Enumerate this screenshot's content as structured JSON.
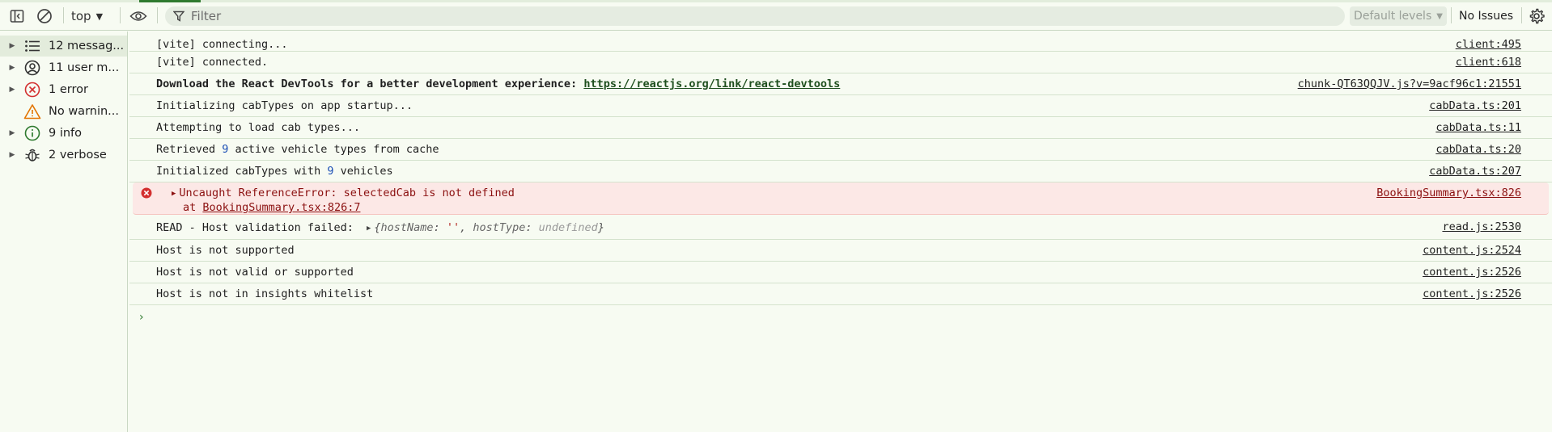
{
  "toolbar": {
    "context": "top",
    "filter_placeholder": "Filter",
    "levels_label": "Default levels",
    "issues_label": "No Issues"
  },
  "sidebar": {
    "items": [
      {
        "label": "12 messag...",
        "icon": "list-icon",
        "selected": true
      },
      {
        "label": "11 user m...",
        "icon": "user-icon"
      },
      {
        "label": "1 error",
        "icon": "error-icon"
      },
      {
        "label": "No warnin...",
        "icon": "warning-icon"
      },
      {
        "label": "9 info",
        "icon": "info-icon"
      },
      {
        "label": "2 verbose",
        "icon": "bug-icon"
      }
    ]
  },
  "console": {
    "rows": [
      {
        "text": "[vite] connecting...",
        "source": "client:495"
      },
      {
        "text": "[vite] connected.",
        "source": "client:618"
      },
      {
        "text": "Download the React DevTools for a better development experience: ",
        "link": "https://reactjs.org/link/react-devtools",
        "source": "chunk-QT63QQJV.js?v=9acf96c1:21551"
      },
      {
        "text": "Initializing cabTypes on app startup...",
        "source": "cabData.ts:201"
      },
      {
        "text": "Attempting to load cab types...",
        "source": "cabData.ts:11"
      },
      {
        "text_a": "Retrieved ",
        "num": "9",
        "text_b": " active vehicle types from cache",
        "source": "cabData.ts:20"
      },
      {
        "text_a": "Initialized cabTypes with ",
        "num": "9",
        "text_b": " vehicles",
        "source": "cabData.ts:207"
      },
      {
        "text": "Uncaught ReferenceError: selectedCab is not defined",
        "stack_prefix": "at ",
        "stack_link": "BookingSummary.tsx:826:7",
        "source": "BookingSummary.tsx:826"
      },
      {
        "text": "READ - Host validation failed: ",
        "obj_open": "{",
        "k1": "hostName",
        "v1": "''",
        "k2": "hostType",
        "v2": "undefined",
        "obj_close": "}",
        "source": "read.js:2530"
      },
      {
        "text": "Host is not supported",
        "source": "content.js:2524"
      },
      {
        "text": "Host is not valid or supported",
        "source": "content.js:2526"
      },
      {
        "text": "Host is not in insights whitelist",
        "source": "content.js:2526"
      }
    ]
  }
}
